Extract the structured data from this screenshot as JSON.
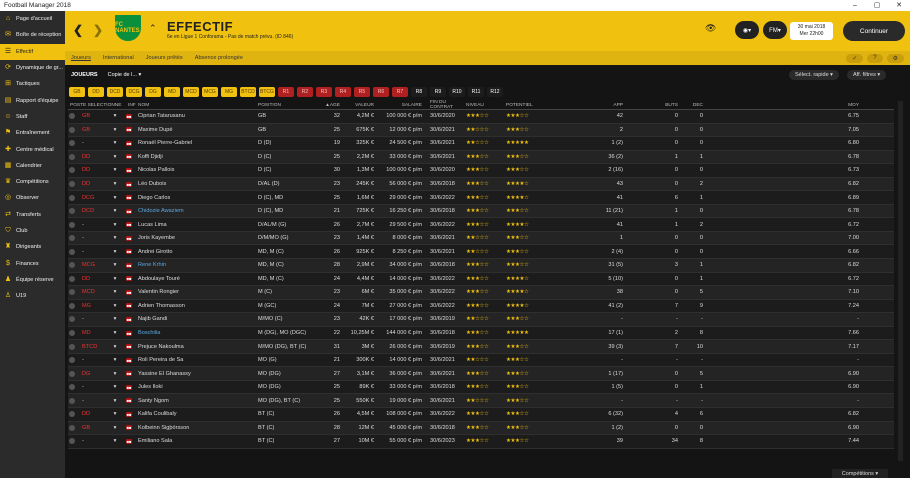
{
  "window": {
    "title": "Football Manager 2018"
  },
  "sidebar": {
    "items": [
      {
        "label": "Page d'accueil",
        "icon": "home-icon"
      },
      {
        "label": "Boîte de réception",
        "icon": "inbox-icon"
      },
      {
        "label": "Effectif",
        "icon": "squad-icon",
        "active": true
      },
      {
        "label": "Dynamique de gr...",
        "icon": "dynamics-icon"
      },
      {
        "label": "Tactiques",
        "icon": "tactics-icon"
      },
      {
        "label": "Rapport d'équipe",
        "icon": "report-icon"
      },
      {
        "label": "Staff",
        "icon": "staff-icon"
      },
      {
        "label": "Entraînement",
        "icon": "training-icon"
      },
      {
        "label": "Centre médical",
        "icon": "medical-icon"
      },
      {
        "label": "Calendrier",
        "icon": "calendar-icon"
      },
      {
        "label": "Compétitions",
        "icon": "trophy-icon"
      },
      {
        "label": "Observer",
        "icon": "scout-icon"
      },
      {
        "label": "Transferts",
        "icon": "transfer-icon"
      },
      {
        "label": "Club",
        "icon": "club-icon"
      },
      {
        "label": "Dirigeants",
        "icon": "board-icon"
      },
      {
        "label": "Finances",
        "icon": "finances-icon"
      },
      {
        "label": "Équipe réserve",
        "icon": "reserve-icon"
      },
      {
        "label": "U19",
        "icon": "u19-icon"
      }
    ]
  },
  "header": {
    "crest_text": "FC NANTES",
    "title": "EFFECTIF",
    "subtitle": "6e en Ligue 1 Conforama - Pas de match prévu. (ID 846)",
    "date_line1": "30 mai 2018",
    "date_line2": "Mer 22h00",
    "continue_label": "Continuer"
  },
  "subnav": {
    "tabs": [
      "Joueurs",
      "International",
      "Joueurs prêtés",
      "Absence prolongée"
    ],
    "tools": [
      "✓",
      "?",
      "⚙"
    ]
  },
  "filterbar": {
    "label": "JOUEURS",
    "view": "Copie de l...",
    "quick": "Sélect. rapide",
    "filters": "Aff. filtres"
  },
  "positions": [
    "GB",
    "DD",
    "DCD",
    "DCG",
    "DG",
    "MD",
    "MCD",
    "MCG",
    "MG",
    "BTCD",
    "BTCG",
    "R1",
    "R2",
    "R3",
    "R4",
    "R5",
    "R6",
    "R7",
    "R8",
    "R9",
    "R10",
    "R11",
    "R12"
  ],
  "colors": {
    "accent": "#f0c20f",
    "sidebar": "#2b2b2b",
    "bg": "#141414",
    "posred": "#e33333"
  },
  "table": {
    "headers": {
      "pos_sel": "POSTE SÉLECTIONNÉ",
      "inf": "INF",
      "name": "NOM",
      "position": "POSITION",
      "age": "▲ÂGE",
      "value": "VALEUR",
      "salary": "SALAIRE",
      "contract": "FIN DU CONTRAT",
      "level": "NIVEAU",
      "potential": "POTENTIEL",
      "apps": "APP",
      "goals": "BUTS",
      "dec": "DÉC",
      "avg": "MOY"
    },
    "rows": [
      {
        "sel": "GB",
        "red": true,
        "name": "Ciprian Tatarusanu",
        "pos": "GB",
        "age": "32",
        "val": "4,2M €",
        "sal": "100 000 € p/m",
        "end": "30/6/2020",
        "lvl": "★★★☆☆",
        "pot": "★★★☆☆",
        "app": "42",
        "goals": "0",
        "dec": "0",
        "avg": "6.75"
      },
      {
        "sel": "GB",
        "red": true,
        "name": "Maxime Dupé",
        "pos": "GB",
        "age": "25",
        "val": "675K €",
        "sal": "12 000 € p/m",
        "end": "30/6/2021",
        "lvl": "★★☆☆☆",
        "pot": "★★★☆☆",
        "app": "2",
        "goals": "0",
        "dec": "0",
        "avg": "7.05"
      },
      {
        "sel": "-",
        "red": false,
        "name": "Ronaël Pierre-Gabriel",
        "pos": "D (D)",
        "age": "19",
        "val": "325K €",
        "sal": "24 500 € p/m",
        "end": "30/6/2021",
        "lvl": "★★☆☆☆",
        "pot": "★★★★★",
        "app": "1 (2)",
        "goals": "0",
        "dec": "0",
        "avg": "6.80"
      },
      {
        "sel": "DD",
        "red": true,
        "name": "Koffi Djidji",
        "pos": "D (C)",
        "age": "25",
        "val": "2,2M €",
        "sal": "33 000 € p/m",
        "end": "30/6/2021",
        "lvl": "★★★☆☆",
        "pot": "★★★☆☆",
        "app": "36 (2)",
        "goals": "1",
        "dec": "1",
        "avg": "6.78"
      },
      {
        "sel": "DD",
        "red": true,
        "name": "Nicolas Pallois",
        "pos": "D (C)",
        "age": "30",
        "val": "1,3M €",
        "sal": "100 000 € p/m",
        "end": "30/6/2020",
        "lvl": "★★★☆☆",
        "pot": "★★★☆☆",
        "app": "2 (16)",
        "goals": "0",
        "dec": "0",
        "avg": "6.73"
      },
      {
        "sel": "DD",
        "red": true,
        "name": "Léo Dubois",
        "pos": "D/AL (D)",
        "age": "23",
        "val": "245K €",
        "sal": "56 000 € p/m",
        "end": "30/6/2018",
        "lvl": "★★★☆☆",
        "pot": "★★★★☆",
        "app": "43",
        "goals": "0",
        "dec": "2",
        "avg": "6.82"
      },
      {
        "sel": "DCG",
        "red": true,
        "name": "Diego Carlos",
        "pos": "D (C), MD",
        "age": "25",
        "val": "1,6M €",
        "sal": "29 000 € p/m",
        "end": "30/6/2022",
        "lvl": "★★★☆☆",
        "pot": "★★★★☆",
        "app": "41",
        "goals": "6",
        "dec": "1",
        "avg": "6.89"
      },
      {
        "sel": "DCD",
        "red": true,
        "name": "Chidozie Awaziem",
        "link": true,
        "pos": "D (C), MD",
        "age": "21",
        "val": "725K €",
        "sal": "16 250 € p/m",
        "end": "30/6/2018",
        "lvl": "★★★☆☆",
        "pot": "★★★☆☆",
        "app": "11 (21)",
        "goals": "1",
        "dec": "0",
        "avg": "6.78"
      },
      {
        "sel": "-",
        "red": false,
        "name": "Lucas Lima",
        "pos": "D/AL/M (G)",
        "age": "26",
        "val": "2,7M €",
        "sal": "29 500 € p/m",
        "end": "30/6/2022",
        "lvl": "★★★☆☆",
        "pot": "★★★★☆",
        "app": "41",
        "goals": "1",
        "dec": "2",
        "avg": "6.72"
      },
      {
        "sel": "-",
        "red": false,
        "name": "Joris Kayembe",
        "pos": "D/M/MO (G)",
        "age": "23",
        "val": "1,4M €",
        "sal": "8 000 € p/m",
        "end": "30/6/2021",
        "lvl": "★★☆☆☆",
        "pot": "★★★☆☆",
        "app": "1",
        "goals": "0",
        "dec": "0",
        "avg": "7.00"
      },
      {
        "sel": "-",
        "red": false,
        "name": "Andrei Girotto",
        "pos": "MD, M (C)",
        "age": "26",
        "val": "925K €",
        "sal": "8 250 € p/m",
        "end": "30/6/2021",
        "lvl": "★★☆☆☆",
        "pot": "★★★☆☆",
        "app": "2 (4)",
        "goals": "0",
        "dec": "0",
        "avg": "6.66"
      },
      {
        "sel": "MCG",
        "red": true,
        "name": "Rene Krhin",
        "link": true,
        "pos": "MD, M (C)",
        "age": "28",
        "val": "2,9M €",
        "sal": "34 000 € p/m",
        "end": "30/6/2018",
        "lvl": "★★★☆☆",
        "pot": "★★★☆☆",
        "app": "31 (5)",
        "goals": "3",
        "dec": "1",
        "avg": "6.82"
      },
      {
        "sel": "DD",
        "red": true,
        "name": "Abdoulaye Touré",
        "pos": "MD, M (C)",
        "age": "24",
        "val": "4,4M €",
        "sal": "14 000 € p/m",
        "end": "30/6/2022",
        "lvl": "★★★☆☆",
        "pot": "★★★★☆",
        "app": "5 (10)",
        "goals": "0",
        "dec": "1",
        "avg": "6.72"
      },
      {
        "sel": "MCD",
        "red": true,
        "name": "Valentin Rongier",
        "pos": "M (C)",
        "age": "23",
        "val": "6M €",
        "sal": "35 000 € p/m",
        "end": "30/6/2022",
        "lvl": "★★★☆☆",
        "pot": "★★★★☆",
        "app": "38",
        "goals": "0",
        "dec": "5",
        "avg": "7.10"
      },
      {
        "sel": "MG",
        "red": true,
        "name": "Adrien Thomasson",
        "pos": "M (GC)",
        "age": "24",
        "val": "7M €",
        "sal": "27 000 € p/m",
        "end": "30/6/2022",
        "lvl": "★★★☆☆",
        "pot": "★★★★☆",
        "app": "41 (2)",
        "goals": "7",
        "dec": "9",
        "avg": "7.24"
      },
      {
        "sel": "-",
        "red": false,
        "name": "Najib Gandi",
        "pos": "M/MO (C)",
        "age": "23",
        "val": "42K €",
        "sal": "17 000 € p/m",
        "end": "30/6/2019",
        "lvl": "★★☆☆☆",
        "pot": "★★★☆☆",
        "app": "-",
        "goals": "-",
        "dec": "-",
        "avg": "-"
      },
      {
        "sel": "MD",
        "red": true,
        "name": "Boschilia",
        "link": true,
        "pos": "M (DG), MO (DGC)",
        "age": "22",
        "val": "10,25M €",
        "sal": "144 000 € p/m",
        "end": "30/6/2018",
        "lvl": "★★★☆☆",
        "pot": "★★★★★",
        "app": "17 (1)",
        "goals": "2",
        "dec": "8",
        "avg": "7.66"
      },
      {
        "sel": "BTCD",
        "red": true,
        "name": "Prejuce Nakoulma",
        "pos": "M/MO (DG), BT (C)",
        "age": "31",
        "val": "3M €",
        "sal": "26 000 € p/m",
        "end": "30/6/2019",
        "lvl": "★★★☆☆",
        "pot": "★★★☆☆",
        "app": "39 (3)",
        "goals": "7",
        "dec": "10",
        "avg": "7.17"
      },
      {
        "sel": "-",
        "red": false,
        "name": "Roli Pereira de Sa",
        "pos": "MO (G)",
        "age": "21",
        "val": "300K €",
        "sal": "14 000 € p/m",
        "end": "30/6/2021",
        "lvl": "★★☆☆☆",
        "pot": "★★★☆☆",
        "app": "-",
        "goals": "-",
        "dec": "-",
        "avg": "-"
      },
      {
        "sel": "DG",
        "red": true,
        "name": "Yassine El Ghanassy",
        "pos": "MO (DG)",
        "age": "27",
        "val": "3,1M €",
        "sal": "36 000 € p/m",
        "end": "30/6/2021",
        "lvl": "★★★☆☆",
        "pot": "★★★☆☆",
        "app": "1 (17)",
        "goals": "0",
        "dec": "5",
        "avg": "6.90"
      },
      {
        "sel": "-",
        "red": false,
        "name": "Jules Iloki",
        "pos": "MO (DG)",
        "age": "25",
        "val": "89K €",
        "sal": "33 000 € p/m",
        "end": "30/6/2018",
        "lvl": "★★★☆☆",
        "pot": "★★★☆☆",
        "app": "1 (5)",
        "goals": "0",
        "dec": "1",
        "avg": "6.90"
      },
      {
        "sel": "-",
        "red": false,
        "name": "Santy Ngom",
        "pos": "MO (DG), BT (C)",
        "age": "25",
        "val": "550K €",
        "sal": "19 000 € p/m",
        "end": "30/6/2021",
        "lvl": "★★☆☆☆",
        "pot": "★★★☆☆",
        "app": "-",
        "goals": "-",
        "dec": "-",
        "avg": "-"
      },
      {
        "sel": "DD",
        "red": true,
        "name": "Kalifa Coulibaly",
        "pos": "BT (C)",
        "age": "26",
        "val": "4,5M €",
        "sal": "108 000 € p/m",
        "end": "30/6/2022",
        "lvl": "★★★☆☆",
        "pot": "★★★☆☆",
        "app": "6 (32)",
        "goals": "4",
        "dec": "6",
        "avg": "6.82"
      },
      {
        "sel": "GB",
        "red": true,
        "name": "Kolbeinn Sigþórsson",
        "pos": "BT (C)",
        "age": "28",
        "val": "12M €",
        "sal": "45 000 € p/m",
        "end": "30/6/2018",
        "lvl": "★★★☆☆",
        "pot": "★★★☆☆",
        "app": "1 (2)",
        "goals": "0",
        "dec": "0",
        "avg": "6.90"
      },
      {
        "sel": "-",
        "red": false,
        "name": "Emiliano Sala",
        "pos": "BT (C)",
        "age": "27",
        "val": "10M €",
        "sal": "55 000 € p/m",
        "end": "30/6/2023",
        "lvl": "★★★☆☆",
        "pot": "★★★☆☆",
        "app": "39",
        "goals": "34",
        "dec": "8",
        "avg": "7.44"
      }
    ]
  },
  "footer": {
    "competitions": "Compétitions"
  }
}
